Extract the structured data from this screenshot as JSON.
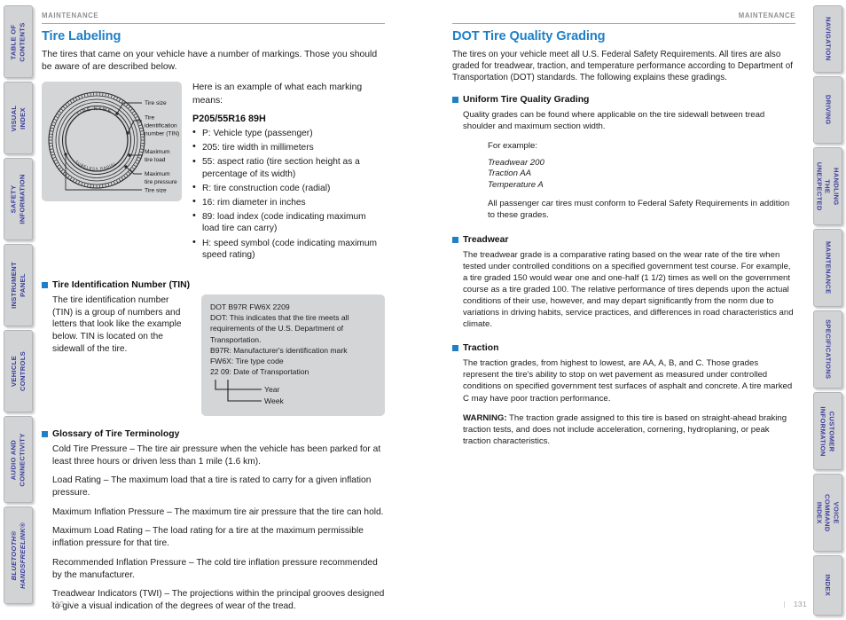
{
  "left_rail": {
    "tabs": [
      {
        "label": "TABLE OF CONTENTS",
        "italic": false
      },
      {
        "label": "VISUAL INDEX",
        "italic": false
      },
      {
        "label": "SAFETY INFORMATION",
        "italic": false
      },
      {
        "label": "INSTRUMENT PANEL",
        "italic": false
      },
      {
        "label": "VEHICLE\nCONTROLS",
        "italic": false
      },
      {
        "label": "AUDIO AND\nCONNECTIVITY",
        "italic": false
      },
      {
        "label": "BLUETOOTH®\nHANDSFREELINK®",
        "italic": true
      }
    ]
  },
  "right_rail": {
    "tabs": [
      {
        "label": "NAVIGATION"
      },
      {
        "label": "DRIVING"
      },
      {
        "label": "HANDLING THE\nUNEXPECTED"
      },
      {
        "label": "MAINTENANCE"
      },
      {
        "label": "SPECIFICATIONS"
      },
      {
        "label": "CUSTOMER\nINFORMATION"
      },
      {
        "label": "VOICE COMMAND\nINDEX"
      },
      {
        "label": "INDEX"
      }
    ]
  },
  "colors": {
    "accent_blue": "#2080c6",
    "tab_text": "#3b3f9c",
    "tab_bg": "#d2d3d5",
    "figure_bg": "#d4d5d7",
    "header_gray": "#8e9194"
  },
  "left_page": {
    "header": "MAINTENANCE",
    "page_number": "130",
    "title": "Tire Labeling",
    "intro": "The tires that came on your vehicle have a number of markings. Those you should be aware of are described below.",
    "figure": {
      "tire_name_text": "TIRE NAME",
      "tire_bottom_text": "TUBELESS RADIAL",
      "labels": [
        "Tire size",
        "Tire identification number (TIN)",
        "Maximum tire load",
        "Maximum tire pressure",
        "Tire size"
      ],
      "label_tire_size_top": "Tire size",
      "label_tin_l1": "Tire",
      "label_tin_l2": "identification",
      "label_tin_l3": "number (TIN)",
      "label_maxload_l1": "Maximum",
      "label_maxload_l2": "tire load",
      "label_maxpress_l1": "Maximum",
      "label_maxpress_l2": "tire pressure",
      "label_tire_size_bottom": "Tire size"
    },
    "marking_intro": "Here is an example of what each marking means:",
    "marking_code": "P205/55R16 89H",
    "markings": [
      "P: Vehicle type (passenger)",
      "205: tire width in millimeters",
      "55: aspect ratio (tire section height as a percentage of its width)",
      "R: tire construction code (radial)",
      "16: rim diameter in inches",
      "89: load index (code indicating maximum load tire can carry)",
      "H: speed symbol (code indicating maximum speed rating)"
    ],
    "tin_section": {
      "heading": "Tire Identification Number (TIN)",
      "text": "The tire identification number (TIN) is a group of numbers and letters that look like the example below. TIN is located on the sidewall of the tire.",
      "box_lines": [
        "DOT B97R FW6X 2209",
        "DOT: This indicates that the tire meets all requirements of the U.S. Department of Transportation.",
        "B97R: Manufacturer's identification mark",
        "FW6X: Tire type code",
        "22 09: Date of Transportation"
      ],
      "bracket_year": "Year",
      "bracket_week": "Week"
    },
    "glossary": {
      "heading": "Glossary of Tire Terminology",
      "entries": [
        "Cold Tire Pressure – The tire air pressure when the vehicle has been parked for at least three hours or driven less than 1 mile (1.6 km).",
        "Load Rating – The maximum load that a tire is rated to carry for a given inflation pressure.",
        "Maximum Inflation Pressure – The maximum tire air pressure that the tire can hold.",
        "Maximum Load Rating – The load rating for a tire at the maximum permissible inflation pressure for that tire.",
        "Recommended Inflation Pressure – The cold tire inflation pressure recommended by the manufacturer.",
        "Treadwear Indicators (TWI) – The projections within the principal grooves designed to give a visual indication of the degrees of wear of the tread."
      ]
    }
  },
  "right_page": {
    "header": "MAINTENANCE",
    "page_number": "131",
    "title": "DOT Tire Quality Grading",
    "intro": "The tires on your vehicle meet all U.S. Federal Safety Requirements. All tires are also graded for treadwear, traction, and temperature performance according to Department of Transportation (DOT) standards. The following explains these gradings.",
    "uniform": {
      "heading": "Uniform Tire Quality Grading",
      "text": "Quality grades can be found where applicable on the tire sidewall between tread shoulder and maximum section width.",
      "example_label": "For example:",
      "example_lines": [
        "Treadwear 200",
        "Traction AA",
        "Temperature A"
      ],
      "tail": "All passenger car tires must conform to Federal Safety Requirements in addition to these grades."
    },
    "treadwear": {
      "heading": "Treadwear",
      "text": "The treadwear grade is a comparative rating based on the wear rate of the tire when tested under controlled conditions on a specified government test course. For example, a tire graded 150 would wear one and one-half (1 1/2) times as well on the government course as a tire graded 100. The relative performance of tires depends upon the actual conditions of their use, however, and may depart significantly from the norm due to variations in driving habits, service practices, and differences in road characteristics and climate."
    },
    "traction": {
      "heading": "Traction",
      "text": "The traction grades, from highest to lowest, are AA, A, B, and C. Those grades represent the tire's ability to stop on wet pavement as measured under controlled conditions on specified government test surfaces of asphalt and concrete. A tire marked C may have poor traction performance.",
      "warning_label": "WARNING:",
      "warning_text": " The traction grade assigned to this tire is based on straight-ahead braking traction tests, and does not include acceleration, cornering, hydroplaning, or peak traction characteristics."
    }
  }
}
